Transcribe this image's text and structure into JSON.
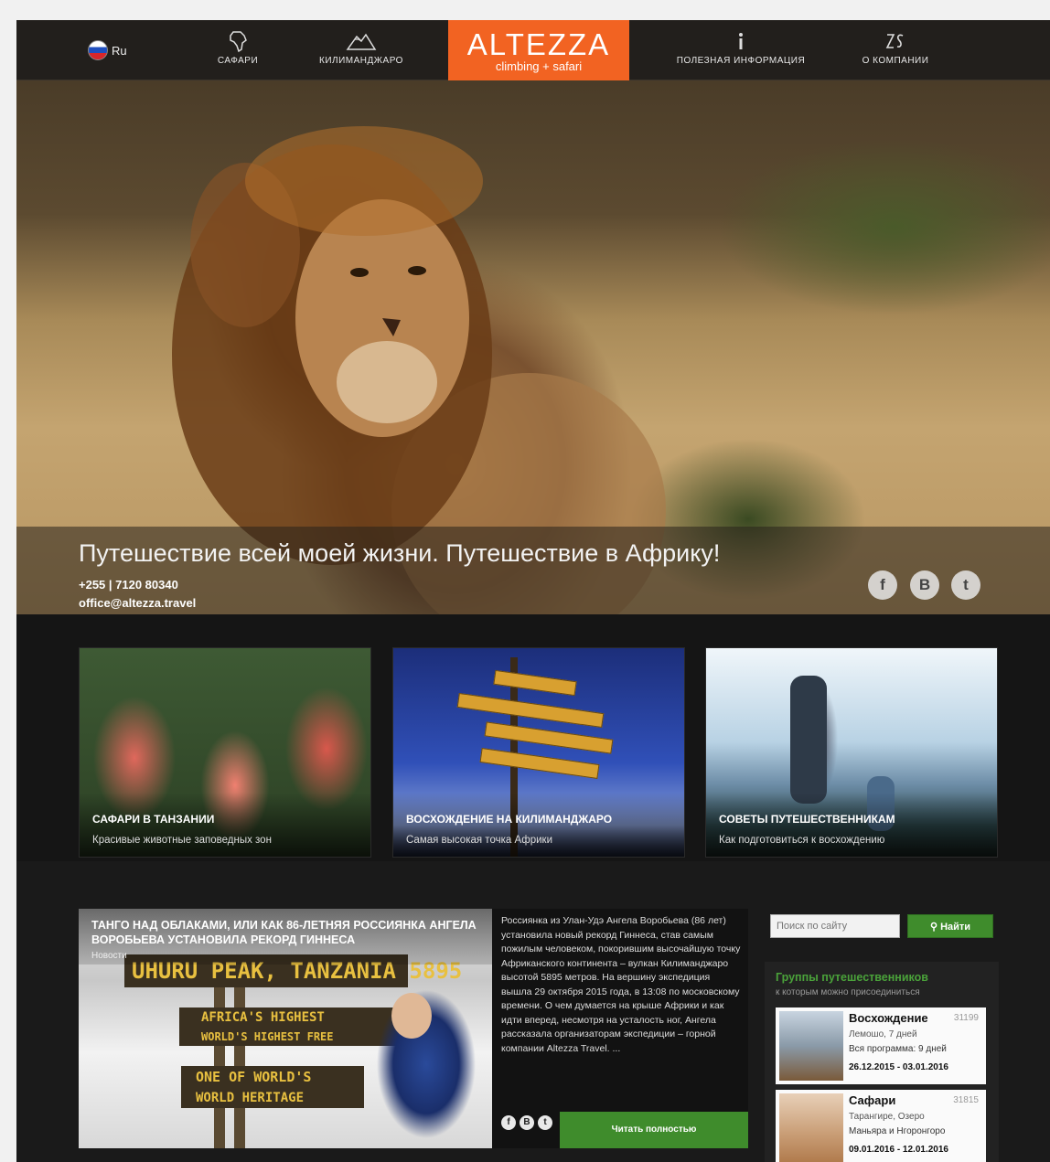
{
  "nav": {
    "lang": "Ru",
    "items": [
      {
        "label": "САФАРИ",
        "icon": "africa-map-icon"
      },
      {
        "label": "КИЛИМАНДЖАРО",
        "icon": "mountain-icon"
      },
      {
        "label": "ПОЛЕЗНАЯ ИНФОРМАЦИЯ",
        "icon": "info-icon"
      },
      {
        "label": "О КОМПАНИИ",
        "icon": "company-icon"
      }
    ],
    "logo": {
      "brand": "ALTEZZA",
      "tagline": "climbing + safari"
    }
  },
  "hero": {
    "title": "Путешествие всей моей жизни. Путешествие в Африку!",
    "phone": "+255 | 7120 80340",
    "email": "office@altezza.travel",
    "social": [
      "f",
      "B",
      "t"
    ]
  },
  "cards": [
    {
      "title": "САФАРИ В ТАНЗАНИИ",
      "subtitle": "Красивые животные заповедных зон"
    },
    {
      "title": "ВОСХОЖДЕНИЕ НА КИЛИМАНДЖАРО",
      "subtitle": "Самая высокая точка Африки"
    },
    {
      "title": "СОВЕТЫ ПУТЕШЕСТВЕННИКАМ",
      "subtitle": "Как подготовиться к восхождению"
    }
  ],
  "news": {
    "title": "ТАНГО НАД ОБЛАКАМИ, ИЛИ КАК 86-ЛЕТНЯЯ РОССИЯНКА АНГЕЛА ВОРОБЬЕВА УСТАНОВИЛА РЕКОРД ГИННЕСА",
    "meta": "Новости",
    "sign_lines": [
      "UHURU PEAK, TANZANIA 5895",
      "AFRICA'S HIGHEST",
      "WORLD'S HIGHEST FREE",
      "ONE OF WORLD'S",
      "WORLD HERITAGE"
    ],
    "text": "Россиянка из Улан-Удэ Ангела Воробьева (86 лет) установила новый рекорд Гиннеса, став самым пожилым человеком, покорившим высочайшую точку Африканского континента – вулкан Килиманджаро высотой 5895 метров. На вершину экспедиция вышла 29 октября 2015 года, в 13:08 по московскому времени. О чем думается на крыше Африки и как идти вперед, несмотря на усталость ног, Ангела рассказала организаторам экспедиции – горной компании Altezza Travel. ...",
    "social": [
      "f",
      "B",
      "t"
    ],
    "read_more": "Читать полностью"
  },
  "sidebar": {
    "search_placeholder": "Поиск по сайту",
    "search_button": "Найти",
    "groups_title": "Группы путешественников",
    "groups_subtitle": "к которым можно присоединиться",
    "groups": [
      {
        "name": "Восхождение",
        "code": "31199",
        "line1": "Лемошо, 7 дней",
        "line2": "Вся программа: 9 дней",
        "dates": "26.12.2015 - 03.01.2016"
      },
      {
        "name": "Сафари",
        "code": "31815",
        "line1": "Тарангире, Озеро",
        "line2": "Маньяра и Нгоронгоро",
        "dates": "09.01.2016 - 12.01.2016"
      }
    ]
  }
}
